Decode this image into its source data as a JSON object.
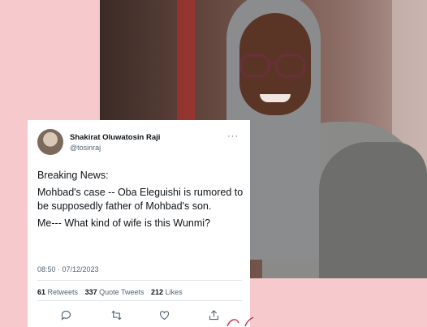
{
  "tweet": {
    "author_name": "Shakirat Oluwatosin Raji",
    "handle": "@tosinraj",
    "more_label": "···",
    "lines": [
      "Breaking News:",
      "Mohbad's case -- Oba Eleguishi is rumored to be supposedly father of Mohbad's son.",
      "Me--- What kind of wife is this Wunmi?"
    ],
    "timestamp": "08:50 · 07/12/2023",
    "stats": {
      "retweets_count": "61",
      "retweets_label": "Retweets",
      "quote_count": "337",
      "quote_label": "Quote Tweets",
      "likes_count": "212",
      "likes_label": "Likes"
    },
    "actions": [
      "reply-icon",
      "retweet-icon",
      "like-icon",
      "share-icon"
    ]
  },
  "colors": {
    "background": "#f6c9cc",
    "card": "#ffffff",
    "text_primary": "#0f1419",
    "text_secondary": "#536471"
  }
}
